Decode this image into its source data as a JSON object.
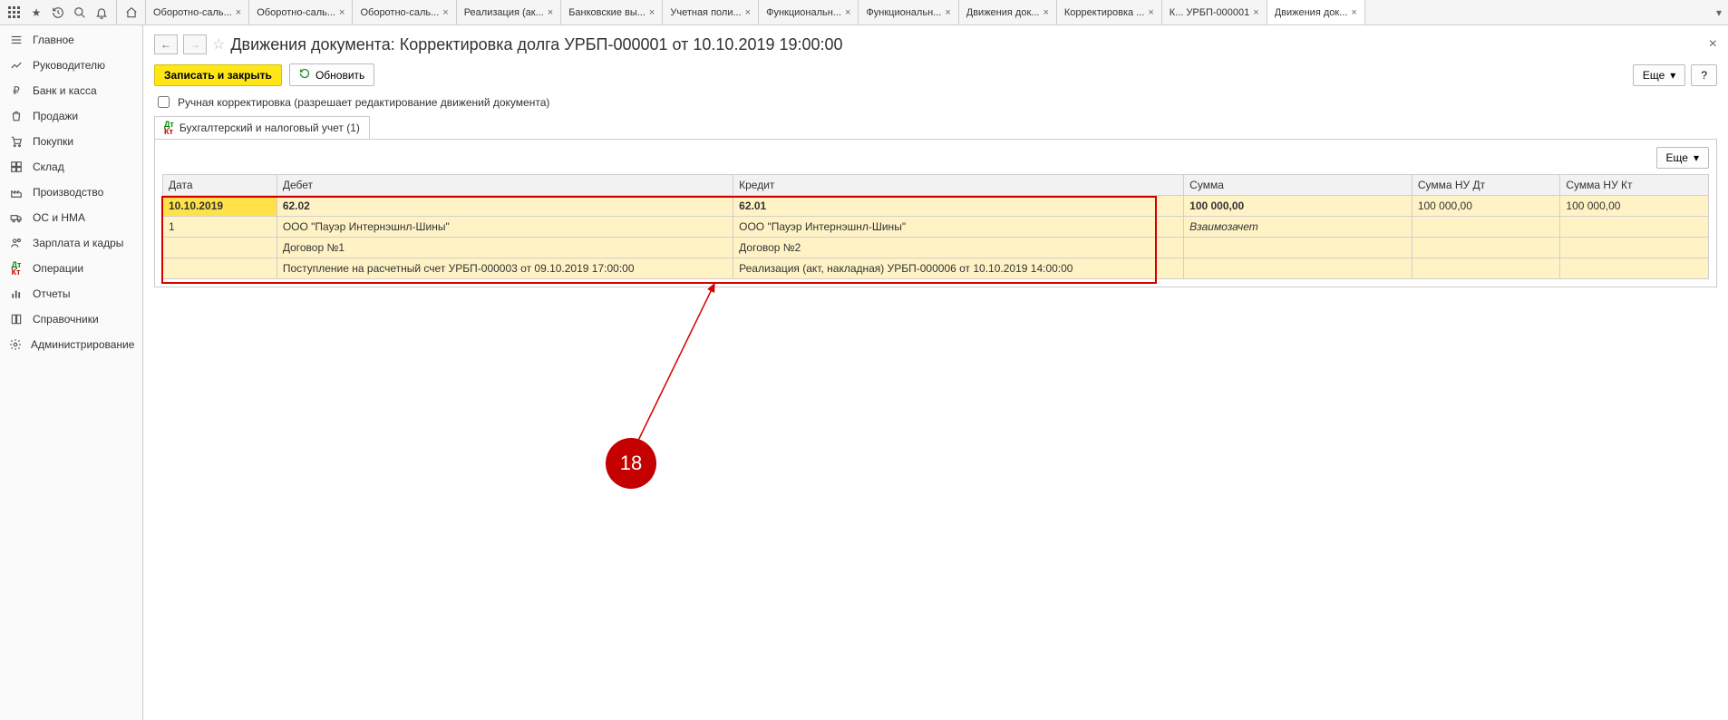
{
  "top_tabs": [
    "Оборотно-саль...",
    "Оборотно-саль...",
    "Оборотно-саль...",
    "Реализация (ак...",
    "Банковские вы...",
    "Учетная поли...",
    "Функциональн...",
    "Функциональн...",
    "Движения док...",
    "Корректировка ...",
    "К... УРБП-000001",
    "Движения док..."
  ],
  "active_tab_index": 11,
  "sidebar": {
    "items": [
      "Главное",
      "Руководителю",
      "Банк и касса",
      "Продажи",
      "Покупки",
      "Склад",
      "Производство",
      "ОС и НМА",
      "Зарплата и кадры",
      "Операции",
      "Отчеты",
      "Справочники",
      "Администрирование"
    ]
  },
  "page": {
    "title": "Движения документа: Корректировка долга УРБП-000001 от 10.10.2019 19:00:00",
    "save_close": "Записать и закрыть",
    "refresh": "Обновить",
    "more": "Еще",
    "manual_edit": "Ручная корректировка (разрешает редактирование движений документа)",
    "tab1": "Бухгалтерский и налоговый учет (1)"
  },
  "table": {
    "headers": {
      "date": "Дата",
      "debet": "Дебет",
      "credit": "Кредит",
      "sum": "Сумма",
      "nudt": "Сумма НУ Дт",
      "nukt": "Сумма НУ Кт"
    },
    "row": {
      "date": "10.10.2019",
      "n": "1",
      "debet_acc": "62.02",
      "credit_acc": "62.01",
      "sum": "100 000,00",
      "nudt": "100 000,00",
      "nukt": "100 000,00",
      "debet_party": "ООО \"Пауэр Интернэшнл-Шины\"",
      "credit_party": "ООО \"Пауэр Интернэшнл-Шины\"",
      "sum_note": "Взаимозачет",
      "debet_contract": "Договор №1",
      "credit_contract": "Договор №2",
      "debet_doc": "Поступление на расчетный счет УРБП-000003 от 09.10.2019 17:00:00",
      "credit_doc": "Реализация (акт, накладная) УРБП-000006 от 10.10.2019 14:00:00"
    }
  },
  "badge": "18"
}
